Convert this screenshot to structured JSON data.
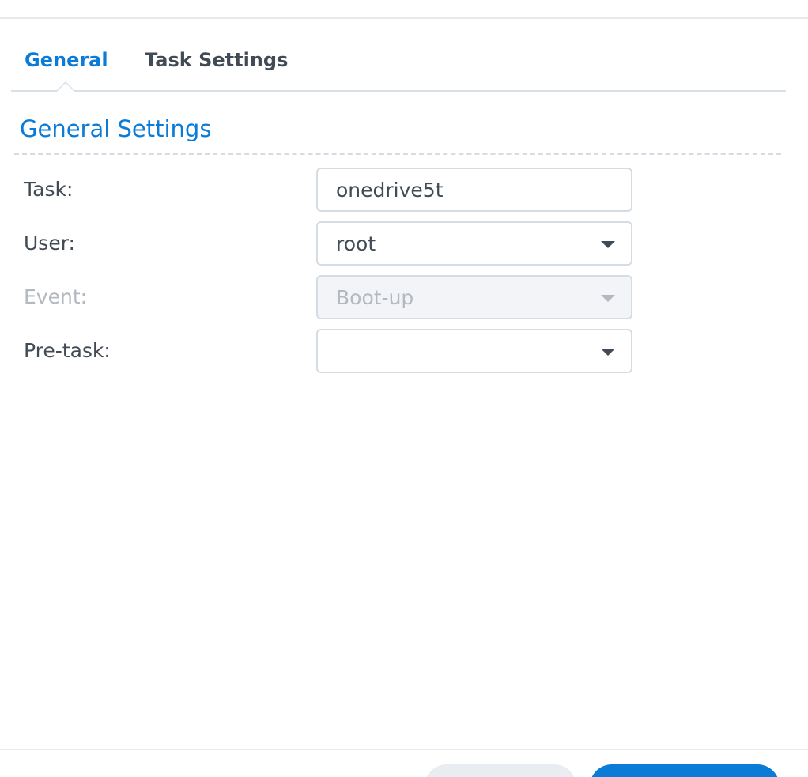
{
  "tabs": [
    {
      "label": "General",
      "active": true
    },
    {
      "label": "Task Settings",
      "active": false
    }
  ],
  "section": {
    "title": "General Settings"
  },
  "form": {
    "task": {
      "label": "Task:",
      "value": "onedrive5t"
    },
    "user": {
      "label": "User:",
      "value": "root"
    },
    "event": {
      "label": "Event:",
      "value": "Boot-up",
      "disabled": true
    },
    "pretask": {
      "label": "Pre-task:",
      "value": ""
    }
  },
  "colors": {
    "accent": "#0a7bd6",
    "text": "#414b55",
    "disabled_text": "#b3b9c0",
    "border": "#d5dce4"
  },
  "icons": {
    "dropdown": "chevron-down-icon"
  }
}
